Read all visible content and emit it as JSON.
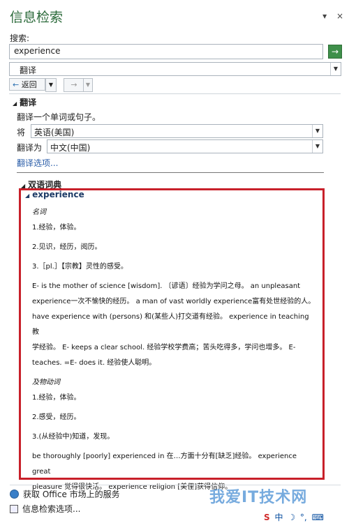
{
  "pane": {
    "title": "信息检索",
    "close_glyph": "×",
    "menu_glyph": "▾"
  },
  "search": {
    "label": "搜索:",
    "value": "experience",
    "go_glyph": "→"
  },
  "service": {
    "selected": "翻译"
  },
  "nav": {
    "back_label": "返回",
    "fwd_label": "→"
  },
  "translate": {
    "section_title": "翻译",
    "hint": "翻译一个单词或句子。",
    "from_label": "将",
    "from_value": "英语(美国)",
    "to_label": "翻译为",
    "to_value": "中文(中国)",
    "options_link": "翻译选项..."
  },
  "dictionary": {
    "section_title": "双语词典",
    "headword": "experience",
    "noun_label": "名词",
    "noun_defs": [
      "1.经验，体验。",
      "2.见识，经历，阅历。",
      "3.［pl.］【宗教】灵性的感受。"
    ],
    "examples_1": [
      "E- is the mother of science [wisdom]. 〔谚语〕经验为学问之母。 an unpleasant",
      "experience一次不愉快的经历。 a man of vast worldly experience富有处世经验的人。",
      "have experience with (persons) 和(某些人)打交道有经验。 experience in teaching 教",
      "学经验。 E- keeps a clear school. 经验学校学费高；苦头吃得多，学问也增多。 E-",
      "teaches. =E- does it. 经验使人聪明。"
    ],
    "verb_label": "及物动词",
    "verb_defs": [
      "1.经验，体验。",
      "2.感受，经历。",
      "3.(从经验中)知道，发现。"
    ],
    "examples_2": [
      "be thoroughly [poorly] experienced in 在…方面十分有[缺乏]经验。 experience great",
      "pleasure 觉得很快活。 experience religion [美俚]获得信仰。"
    ]
  },
  "footer": {
    "office_link": "获取 Office 市场上的服务",
    "options_link": "信息检索选项..."
  },
  "watermark": "我爱IT技术网",
  "ime": {
    "s": "S",
    "zh": "中",
    "moon": "☽",
    "punct": "°,",
    "keyboard": "⌨"
  }
}
